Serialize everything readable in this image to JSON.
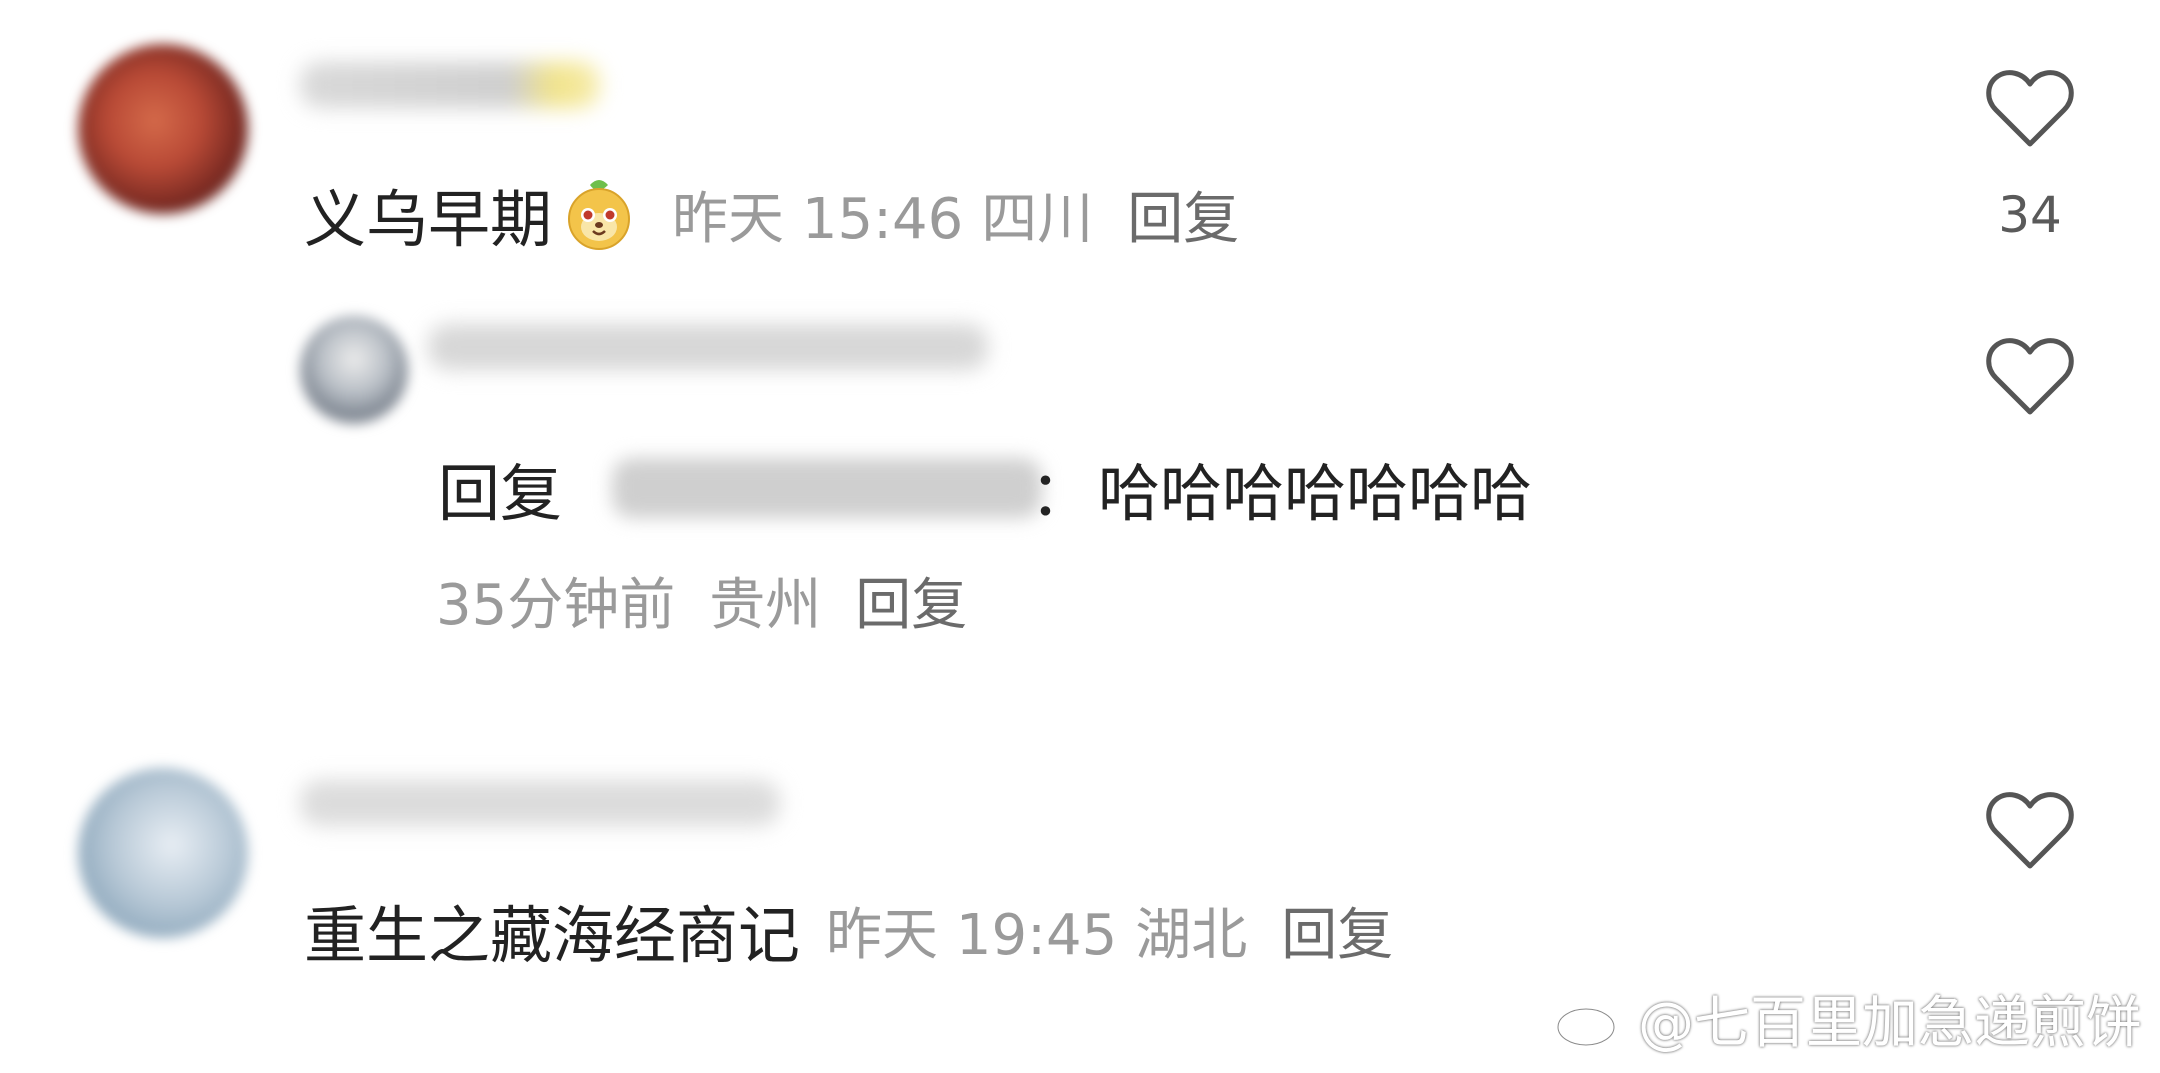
{
  "comments": [
    {
      "text": "义乌早期",
      "emoji": "sticker-emoji",
      "time": "昨天 15:46",
      "location": "四川",
      "reply_label": "回复",
      "like_count": "34"
    },
    {
      "reply_prefix": "回复",
      "reply_sep": "：",
      "text": "哈哈哈哈哈哈哈",
      "time": "35分钟前",
      "location": "贵州",
      "reply_label": "回复"
    },
    {
      "text": "重生之藏海经商记",
      "time": "昨天 19:45",
      "location": "湖北",
      "reply_label": "回复"
    }
  ],
  "icons": {
    "like": "heart-outline-icon",
    "watermark": "weibo-logo-icon"
  },
  "watermark": {
    "text": "@七百里加急递煎饼"
  },
  "colors": {
    "text": "#222222",
    "meta": "#9a9a9a",
    "heart": "#555555"
  }
}
